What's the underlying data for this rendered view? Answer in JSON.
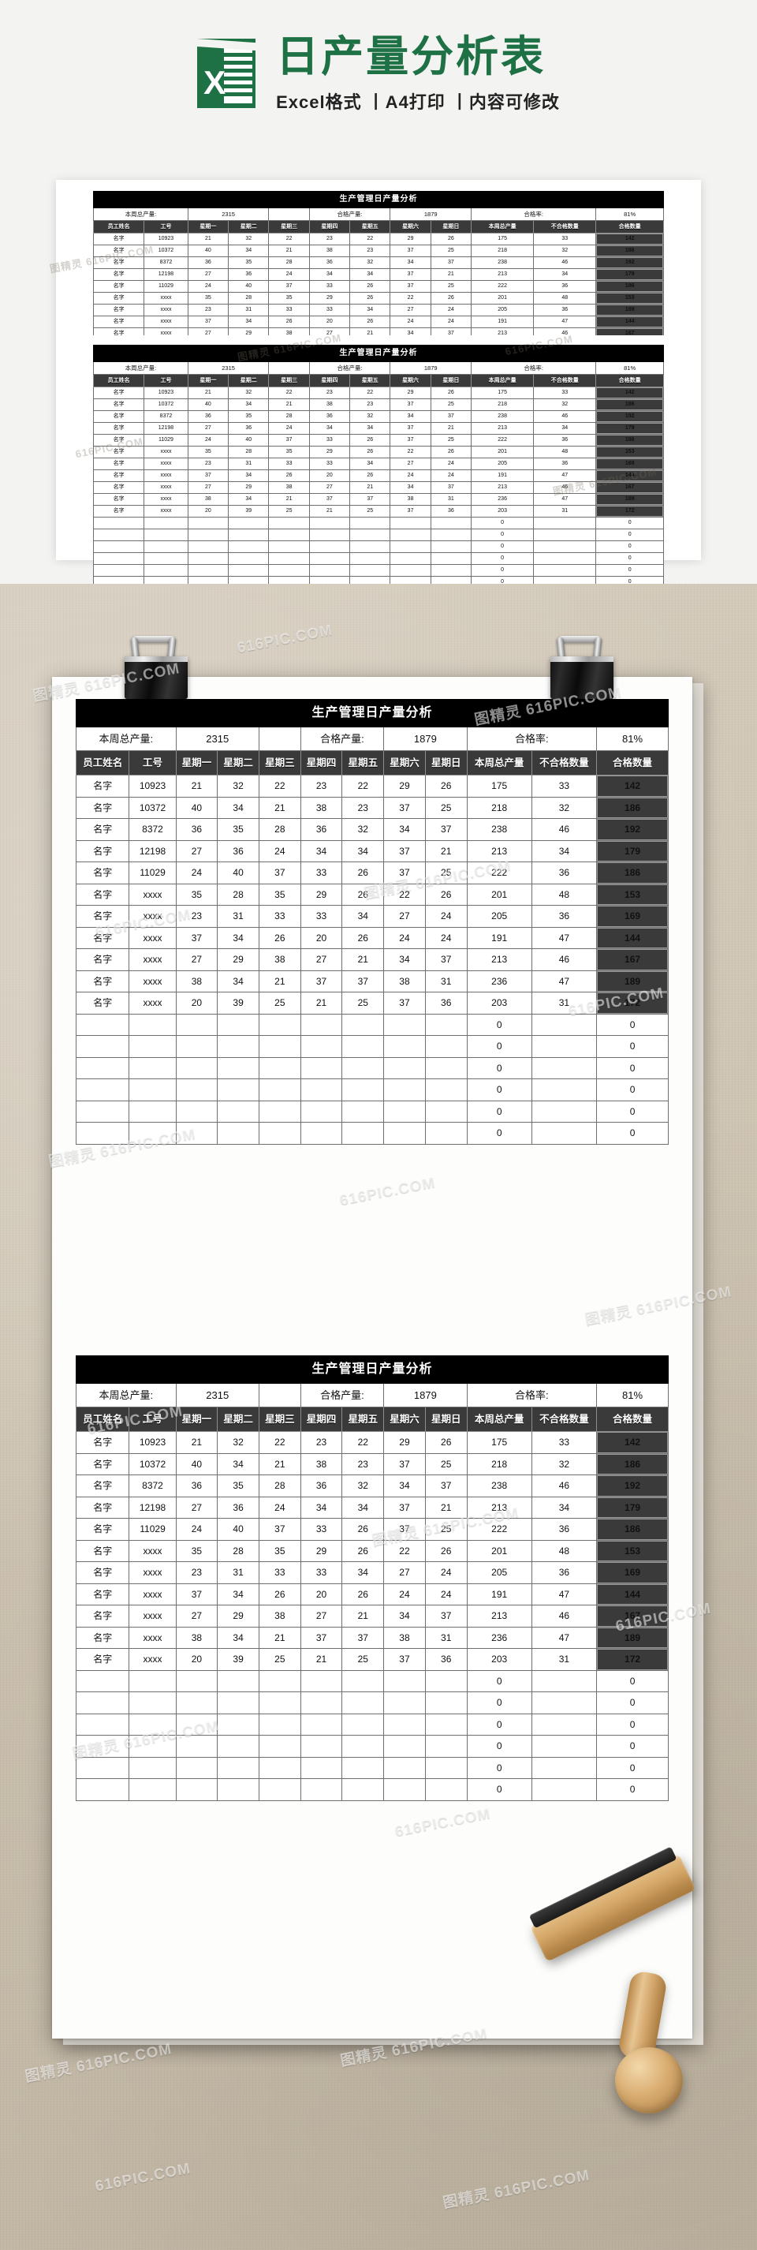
{
  "brand": {
    "logo_letter": "X",
    "title": "日产量分析表",
    "subtitle": "Excel格式 丨A4打印 丨内容可修改"
  },
  "watermark": {
    "text_a": "图精灵 616PIC.COM",
    "text_b": "616PIC.COM"
  },
  "sheet": {
    "title": "生产管理日产量分析",
    "summary": {
      "total_label": "本周总产量:",
      "total_value": "2315",
      "spacer": "",
      "pass_label": "合格产量:",
      "pass_value": "1879",
      "rate_label": "合格率:",
      "rate_value": "81%"
    },
    "columns": [
      "员工姓名",
      "工号",
      "星期一",
      "星期二",
      "星期三",
      "星期四",
      "星期五",
      "星期六",
      "星期日",
      "本周总产量",
      "不合格数量",
      "合格数量"
    ],
    "rows": [
      [
        "名字",
        "10923",
        "21",
        "32",
        "22",
        "23",
        "22",
        "29",
        "26",
        "175",
        "33",
        "142"
      ],
      [
        "名字",
        "10372",
        "40",
        "34",
        "21",
        "38",
        "23",
        "37",
        "25",
        "218",
        "32",
        "186"
      ],
      [
        "名字",
        "8372",
        "36",
        "35",
        "28",
        "36",
        "32",
        "34",
        "37",
        "238",
        "46",
        "192"
      ],
      [
        "名字",
        "12198",
        "27",
        "36",
        "24",
        "34",
        "34",
        "37",
        "21",
        "213",
        "34",
        "179"
      ],
      [
        "名字",
        "11029",
        "24",
        "40",
        "37",
        "33",
        "26",
        "37",
        "25",
        "222",
        "36",
        "186"
      ],
      [
        "名字",
        "xxxx",
        "35",
        "28",
        "35",
        "29",
        "26",
        "22",
        "26",
        "201",
        "48",
        "153"
      ],
      [
        "名字",
        "xxxx",
        "23",
        "31",
        "33",
        "33",
        "34",
        "27",
        "24",
        "205",
        "36",
        "169"
      ],
      [
        "名字",
        "xxxx",
        "37",
        "34",
        "26",
        "20",
        "26",
        "24",
        "24",
        "191",
        "47",
        "144"
      ],
      [
        "名字",
        "xxxx",
        "27",
        "29",
        "38",
        "27",
        "21",
        "34",
        "37",
        "213",
        "46",
        "167"
      ],
      [
        "名字",
        "xxxx",
        "38",
        "34",
        "21",
        "37",
        "37",
        "38",
        "31",
        "236",
        "47",
        "189"
      ],
      [
        "名字",
        "xxxx",
        "20",
        "39",
        "25",
        "21",
        "25",
        "37",
        "36",
        "203",
        "31",
        "172"
      ]
    ],
    "blank_rows": [
      [
        "",
        "",
        "",
        "",
        "",
        "",
        "",
        "",
        "",
        "0",
        "",
        "0"
      ],
      [
        "",
        "",
        "",
        "",
        "",
        "",
        "",
        "",
        "",
        "0",
        "",
        "0"
      ],
      [
        "",
        "",
        "",
        "",
        "",
        "",
        "",
        "",
        "",
        "0",
        "",
        "0"
      ],
      [
        "",
        "",
        "",
        "",
        "",
        "",
        "",
        "",
        "",
        "0",
        "",
        "0"
      ],
      [
        "",
        "",
        "",
        "",
        "",
        "",
        "",
        "",
        "",
        "0",
        "",
        "0"
      ],
      [
        "",
        "",
        "",
        "",
        "",
        "",
        "",
        "",
        "",
        "0",
        "",
        "0"
      ]
    ]
  },
  "colors": {
    "brand_green": "#1e7145",
    "header_black": "#000000",
    "head_row_gray": "#3a3a3a",
    "pass_cell_gray": "#3a3a3a"
  }
}
